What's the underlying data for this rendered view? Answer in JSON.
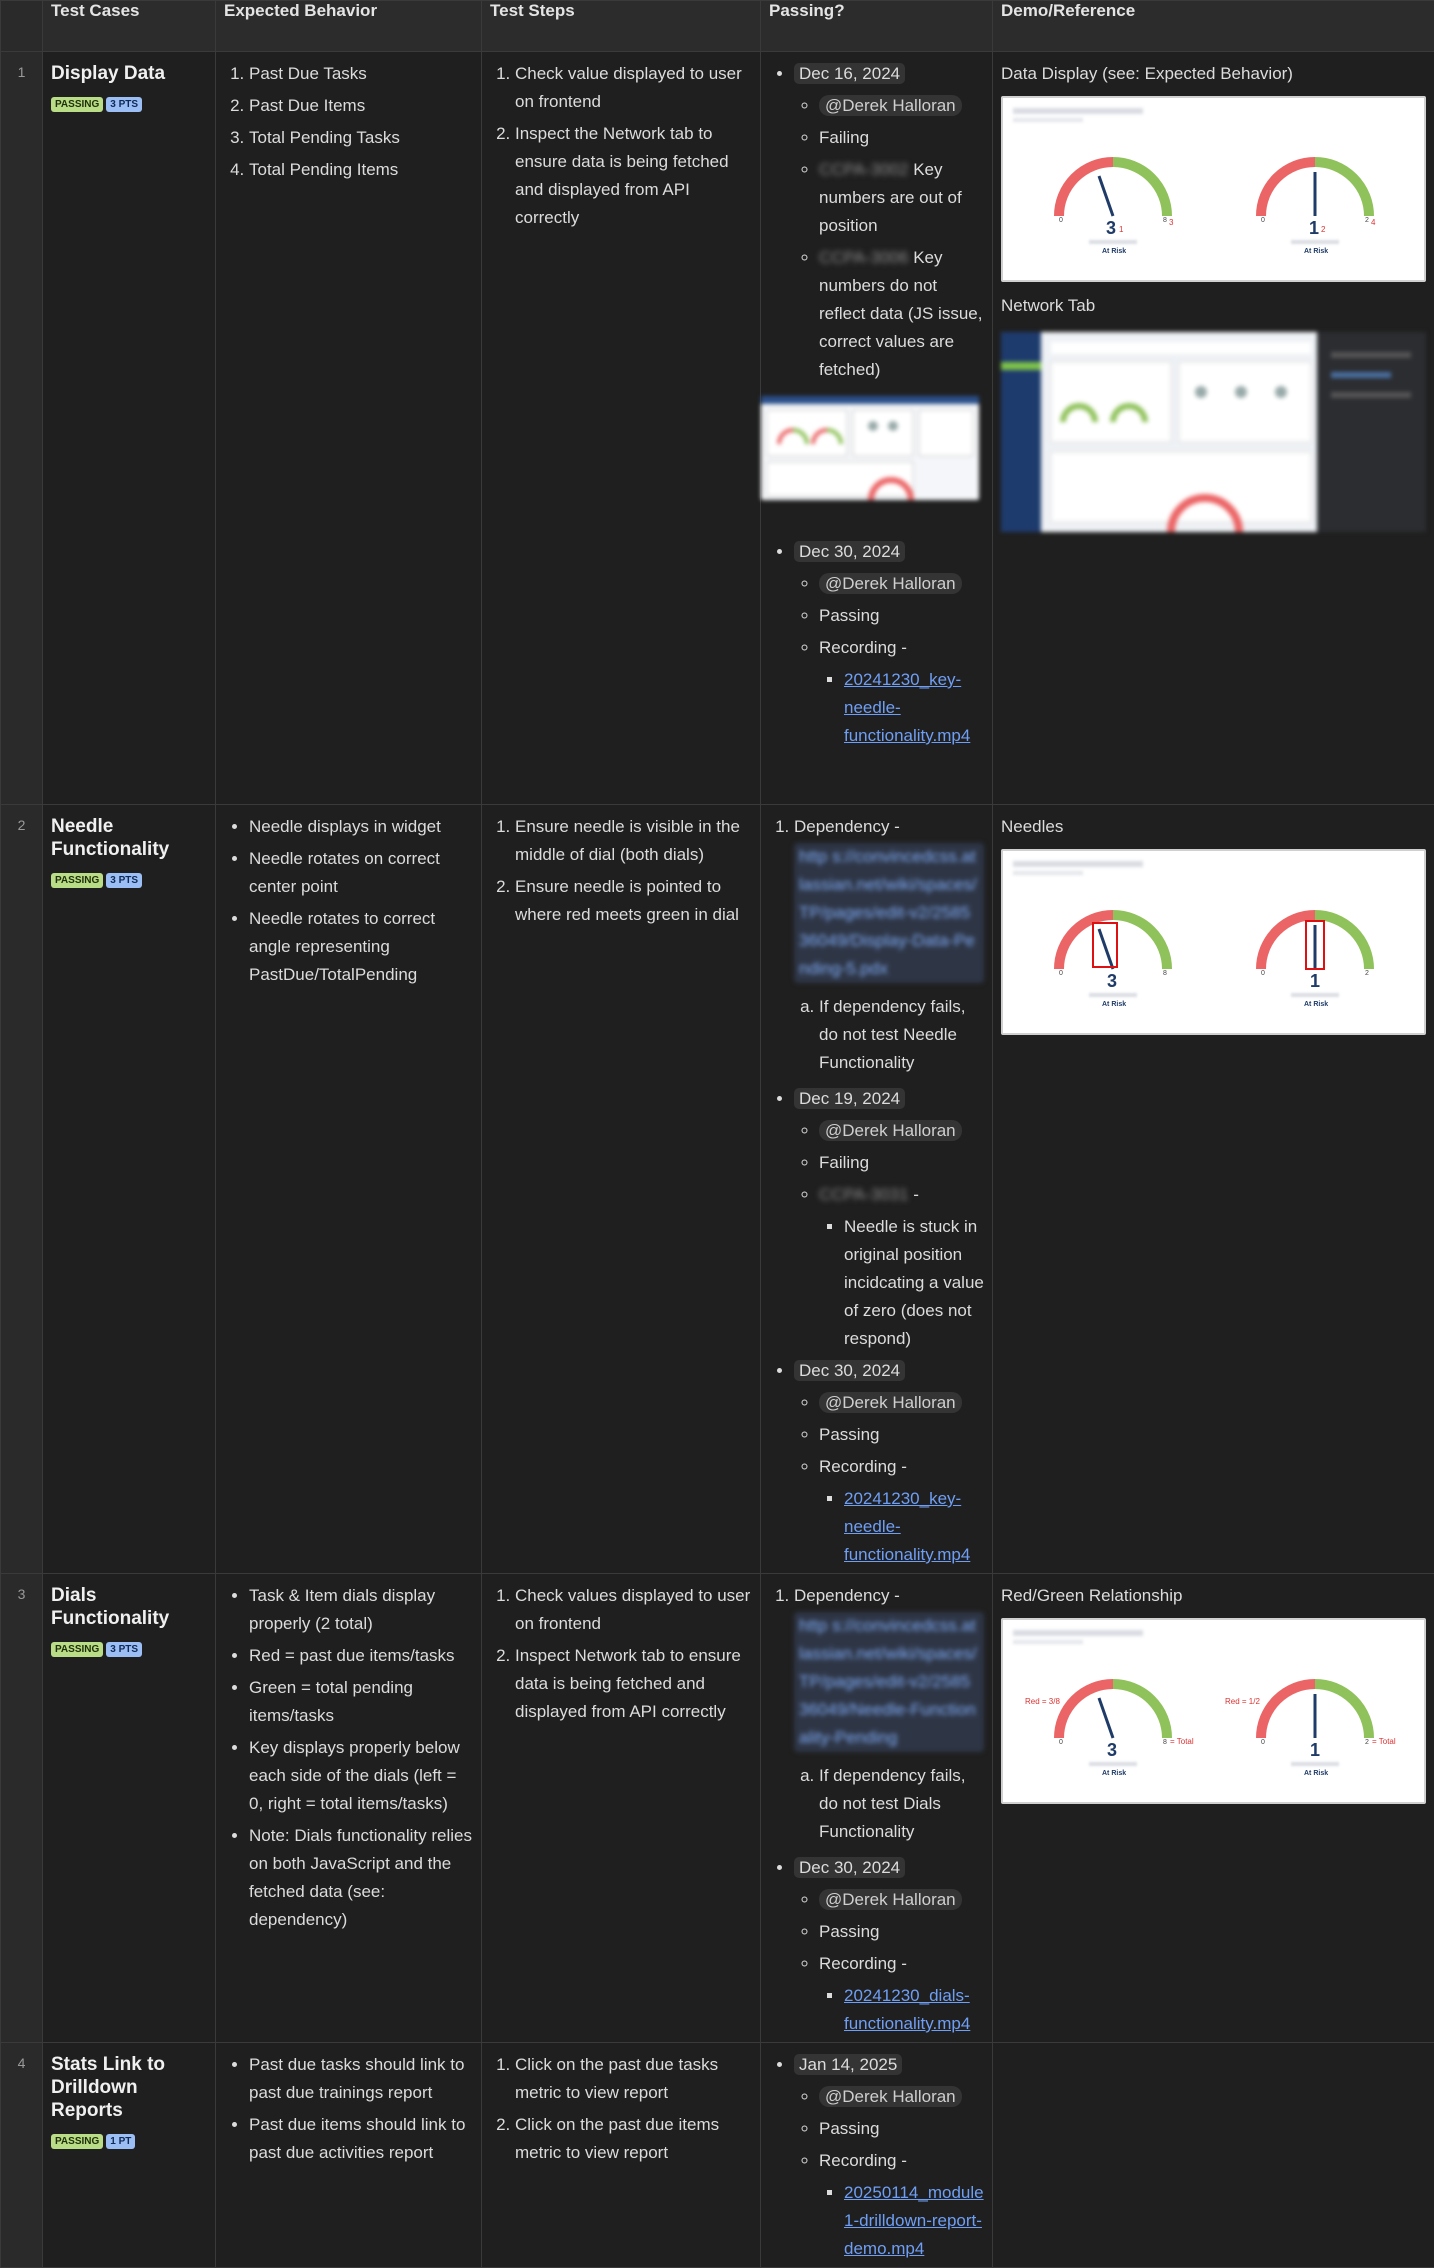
{
  "headers": [
    "",
    "Test Cases",
    "Expected Behavior",
    "Test Steps",
    "Passing?",
    "Demo/Reference"
  ],
  "rows": [
    {
      "num": "1",
      "title": "Display Data",
      "badges": [
        "PASSING",
        "3 PTS"
      ],
      "expected": [
        "Past Due Tasks",
        "Past Due Items",
        "Total Pending Tasks",
        "Total Pending Items"
      ],
      "steps": [
        "Check value displayed to user on frontend",
        "Inspect the Network tab to ensure data is being fetched and displayed from API correctly"
      ],
      "passing": {
        "e1_date": "Dec 16, 2024",
        "e1_user": "@Derek Halloran",
        "e1_status": "Failing",
        "e1_issue1_ref": "CCPA-3002",
        "e1_issue1": "Key numbers are out of position",
        "e1_issue2_ref": "CCPA-3006",
        "e1_issue2": "Key numbers do not reflect data (JS issue, correct values are fetched)",
        "e2_date": "Dec 30, 2024",
        "e2_user": "@Derek Halloran",
        "e2_status": "Passing",
        "e2_rec": "Recording -",
        "e2_file": "20241230_key-needle-functionality.mp4"
      },
      "demo": {
        "label1": "Data Display (see: Expected Behavior)",
        "label2": "Network Tab",
        "g1": {
          "value": "3",
          "min": "0",
          "max": "8",
          "key_sub": "1",
          "key_max_sup": "3",
          "caption": "At Risk"
        },
        "g2": {
          "value": "1",
          "min": "0",
          "max": "2",
          "key_sub": "2",
          "key_max_sup": "4",
          "caption": "At Risk"
        }
      }
    },
    {
      "num": "2",
      "title": "Needle Functionality",
      "badges": [
        "PASSING",
        "3 PTS"
      ],
      "expected": [
        "Needle displays in widget",
        "Needle rotates on correct center point",
        "Needle rotates to correct angle representing PastDue/TotalPending"
      ],
      "steps": [
        "Ensure needle is visible in the middle of dial (both dials)",
        "Ensure needle is pointed to where red meets green in dial"
      ],
      "passing": {
        "dep_label": "Dependency -",
        "dep_link": "http s://convincedcss.atlassian.net/wiki/spaces/TP/pages/edit-v2/258536049/Display-Data-Pending-5.pdx",
        "dep_note": "If dependency fails, do not test Needle Functionality",
        "e1_date": "Dec 19, 2024",
        "e1_user": "@Derek Halloran",
        "e1_status": "Failing",
        "e1_issue_ref": "CCPA-3031",
        "e1_issue_sep": "-",
        "e1_issue": "Needle is stuck in original position incidcating a value of zero (does not respond)",
        "e2_date": "Dec 30, 2024",
        "e2_user": "@Derek Halloran",
        "e2_status": "Passing",
        "e2_rec": "Recording -",
        "e2_file": "20241230_key-needle-functionality.mp4"
      },
      "demo": {
        "label1": "Needles",
        "g1": {
          "value": "3",
          "min": "0",
          "max": "8",
          "caption": "At Risk"
        },
        "g2": {
          "value": "1",
          "min": "0",
          "max": "2",
          "caption": "At Risk"
        }
      }
    },
    {
      "num": "3",
      "title": "Dials Functionality",
      "badges": [
        "PASSING",
        "3 PTS"
      ],
      "expected": [
        "Task & Item dials display properly (2 total)",
        "Red = past due items/tasks",
        "Green = total pending items/tasks",
        "Key displays properly below each side of the dials (left = 0, right = total items/tasks)",
        "Note: Dials functionality relies on both JavaScript and the fetched data (see: dependency)"
      ],
      "steps": [
        "Check values displayed to user on frontend",
        "Inspect Network tab to ensure data is being fetched and displayed from API correctly"
      ],
      "passing": {
        "dep_label": "Dependency -",
        "dep_link": "http s://convincedcss.atlassian.net/wiki/spaces/TP/pages/edit-v2/258536049/Needle-Functionality-Pending",
        "dep_note": "If dependency fails, do not test Dials Functionality",
        "e1_date": "Dec 30, 2024",
        "e1_user": "@Derek Halloran",
        "e1_status": "Passing",
        "e1_rec": "Recording -",
        "e1_file": "20241230_dials-functionality.mp4"
      },
      "demo": {
        "label1": "Red/Green Relationship",
        "g1": {
          "value": "3",
          "min": "0",
          "max": "8",
          "red_note": "Red = 3/8",
          "green_note": "= Total",
          "caption": "At Risk"
        },
        "g2": {
          "value": "1",
          "min": "0",
          "max": "2",
          "red_note": "Red = 1/2",
          "green_note": "= Total",
          "caption": "At Risk"
        }
      }
    },
    {
      "num": "4",
      "title": "Stats Link to Drilldown Reports",
      "badges": [
        "PASSING",
        "1 PT"
      ],
      "expected": [
        "Past due tasks should link to past due trainings report",
        "Past due items should link to past due activities report"
      ],
      "steps": [
        "Click on the past due tasks metric to view report",
        "Click on the past due items metric to view report"
      ],
      "passing": {
        "e1_date": "Jan 14, 2025",
        "e1_user": "@Derek Halloran",
        "e1_status": "Passing",
        "e1_rec": "Recording -",
        "e1_file": "20250114_module1-drilldown-report-demo.mp4"
      }
    }
  ],
  "colors": {
    "red": "#ec6566",
    "green": "#8fc25a",
    "needle": "#1f3b68",
    "link": "#6f9ff5",
    "pass_badge": "#b9dc86",
    "pts_badge": "#9bbef5"
  }
}
